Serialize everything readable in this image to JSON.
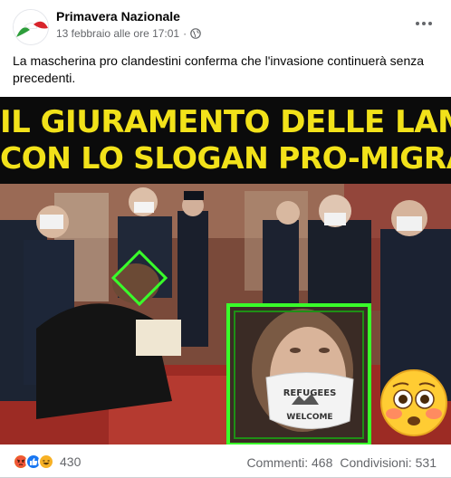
{
  "post": {
    "page_name": "Primavera Nazionale",
    "timestamp": "13 febbraio alle ore 17:01",
    "separator": "·",
    "privacy_icon": "globe-icon",
    "more_icon": "more-options-icon",
    "caption": "La mascherina pro clandestini conferma che l'invasione continuerà senza precedenti."
  },
  "image": {
    "headline_line1": "IL GIURAMENTO DELLE LAMORGESE",
    "headline_line2": "CON LO SLOGAN PRO-MIGRANTI!!!",
    "mask_text_line1": "REFUGEES",
    "mask_text_line2": "WELCOME",
    "highlight_color": "#39ff2a",
    "headline_color": "#f2e21a"
  },
  "footer": {
    "reactions": [
      "angry-icon",
      "like-icon",
      "haha-icon"
    ],
    "reaction_count": "430",
    "comments": "Commenti: 468",
    "shares": "Condivisioni: 531"
  }
}
